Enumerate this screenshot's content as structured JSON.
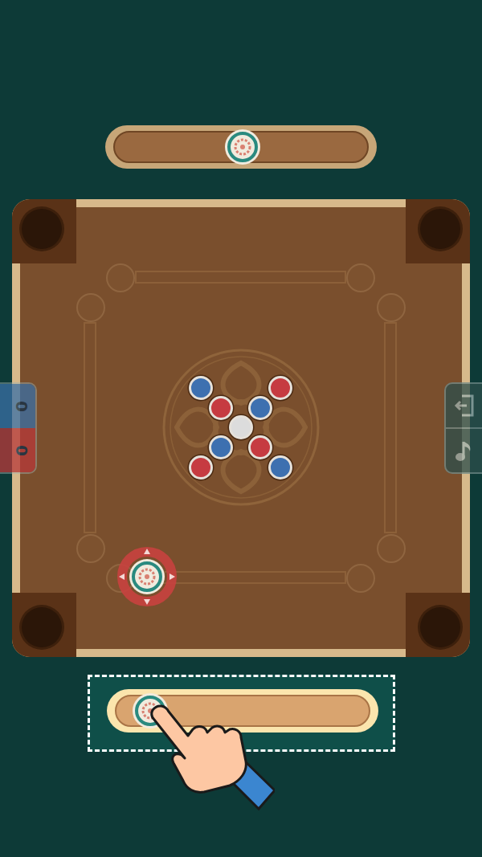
{
  "scores": [
    {
      "value": "0",
      "color": "#3a70a6"
    },
    {
      "value": "0",
      "color": "#b8393a"
    }
  ],
  "opponent_slider": {
    "level": 0.5
  },
  "player_slider": {
    "level": 0.07
  },
  "coins": [
    {
      "color": "#3d70b0"
    },
    {
      "color": "#c63b41"
    },
    {
      "color": "#c63b41"
    },
    {
      "color": "#3d70b0"
    },
    {
      "color": "#dcdcdc"
    },
    {
      "color": "#3d70b0"
    },
    {
      "color": "#c63b41"
    },
    {
      "color": "#c63b41"
    },
    {
      "color": "#3d70b0"
    }
  ]
}
